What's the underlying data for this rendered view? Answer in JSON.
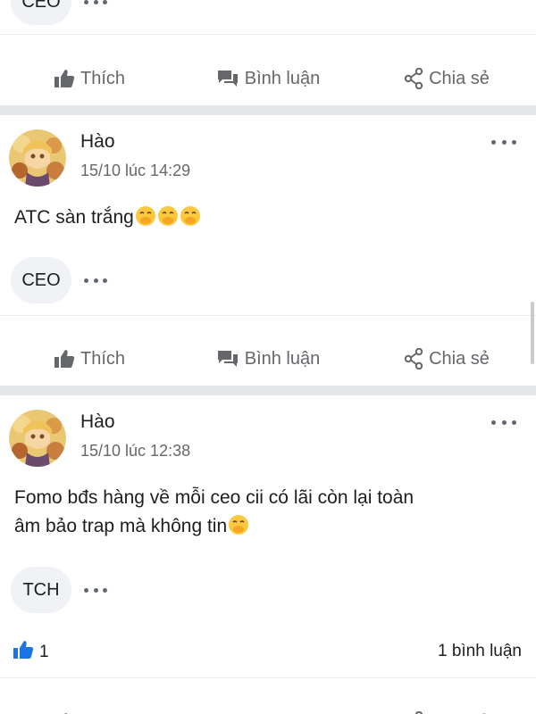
{
  "colors": {
    "divider": "#e4e6e9",
    "like_blue": "#1b74e4",
    "muted": "#65676b"
  },
  "actions": {
    "like_label": "Thích",
    "comment_label": "Bình luận",
    "share_label": "Chia sẻ"
  },
  "prev_post": {
    "tag": "CEO"
  },
  "posts": [
    {
      "author": "Hào",
      "time": "15/10 lúc 14:29",
      "content": "ATC sàn trắng",
      "emoji": "🤭🤭🤭",
      "tag": "CEO"
    },
    {
      "author": "Hào",
      "time": "15/10 lúc 12:38",
      "content_line1": "Fomo bđs hàng về mỗi ceo cii có lãi còn lại toàn",
      "content_line2": "âm bảo trap mà không tin",
      "emoji": "🤭",
      "tag": "TCH",
      "like_count": "1",
      "comment_count": "1 bình luận"
    }
  ],
  "icons": {
    "more": "more-horizontal-icon",
    "like": "thumbs-up-icon",
    "comment": "comment-icon",
    "share": "share-icon"
  }
}
